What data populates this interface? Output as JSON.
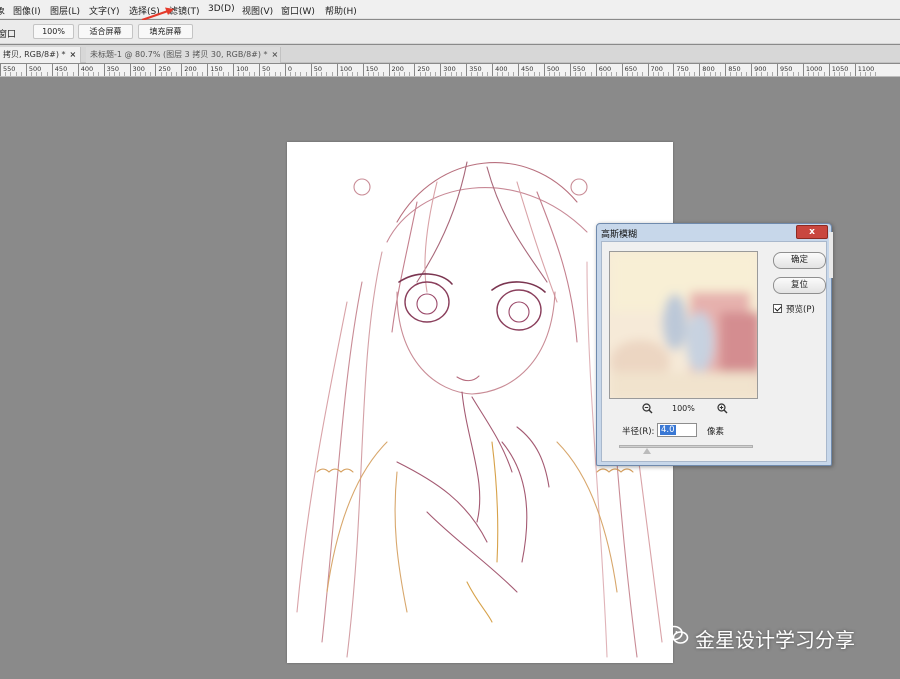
{
  "menu": {
    "items": [
      "象",
      "图像(I)",
      "图层(L)",
      "文字(Y)",
      "选择(S)",
      "滤镜(T)",
      "3D(D)",
      "视图(V)",
      "窗口(W)",
      "帮助(H)"
    ]
  },
  "options": {
    "partial_label": "窗口",
    "zoom_value": "100%",
    "fit_screen": "适合屏幕",
    "fill_screen": "填充屏幕"
  },
  "tabs": [
    {
      "label": "拷贝, RGB/8#) *",
      "close": "×"
    },
    {
      "label": "未标题-1 @ 80.7% (图层 3 拷贝 30, RGB/8#) *",
      "close": "×"
    }
  ],
  "ruler": {
    "labels": [
      "550",
      "500",
      "450",
      "400",
      "350",
      "300",
      "250",
      "200",
      "150",
      "100",
      "50",
      "0",
      "50",
      "100",
      "150",
      "200",
      "250",
      "300",
      "350",
      "400",
      "450",
      "500",
      "550",
      "600",
      "650",
      "700",
      "750",
      "800",
      "850",
      "900",
      "950",
      "1000",
      "1050",
      "1100"
    ]
  },
  "dialog": {
    "title": "高斯模糊",
    "close": "x",
    "ok": "确定",
    "reset": "复位",
    "preview_label": "预览(P)",
    "preview_checked": true,
    "zoom_percent": "100%",
    "radius_label": "半径(R):",
    "radius_value": "4.0",
    "radius_unit": "像素"
  },
  "watermark": {
    "text": "金星设计学习分享"
  },
  "colors": {
    "workspace": "#8a8a8a",
    "dialog_frame": "#c7d7ea",
    "accent_arrow": "#e53a2b",
    "selection": "#3a78d4"
  }
}
